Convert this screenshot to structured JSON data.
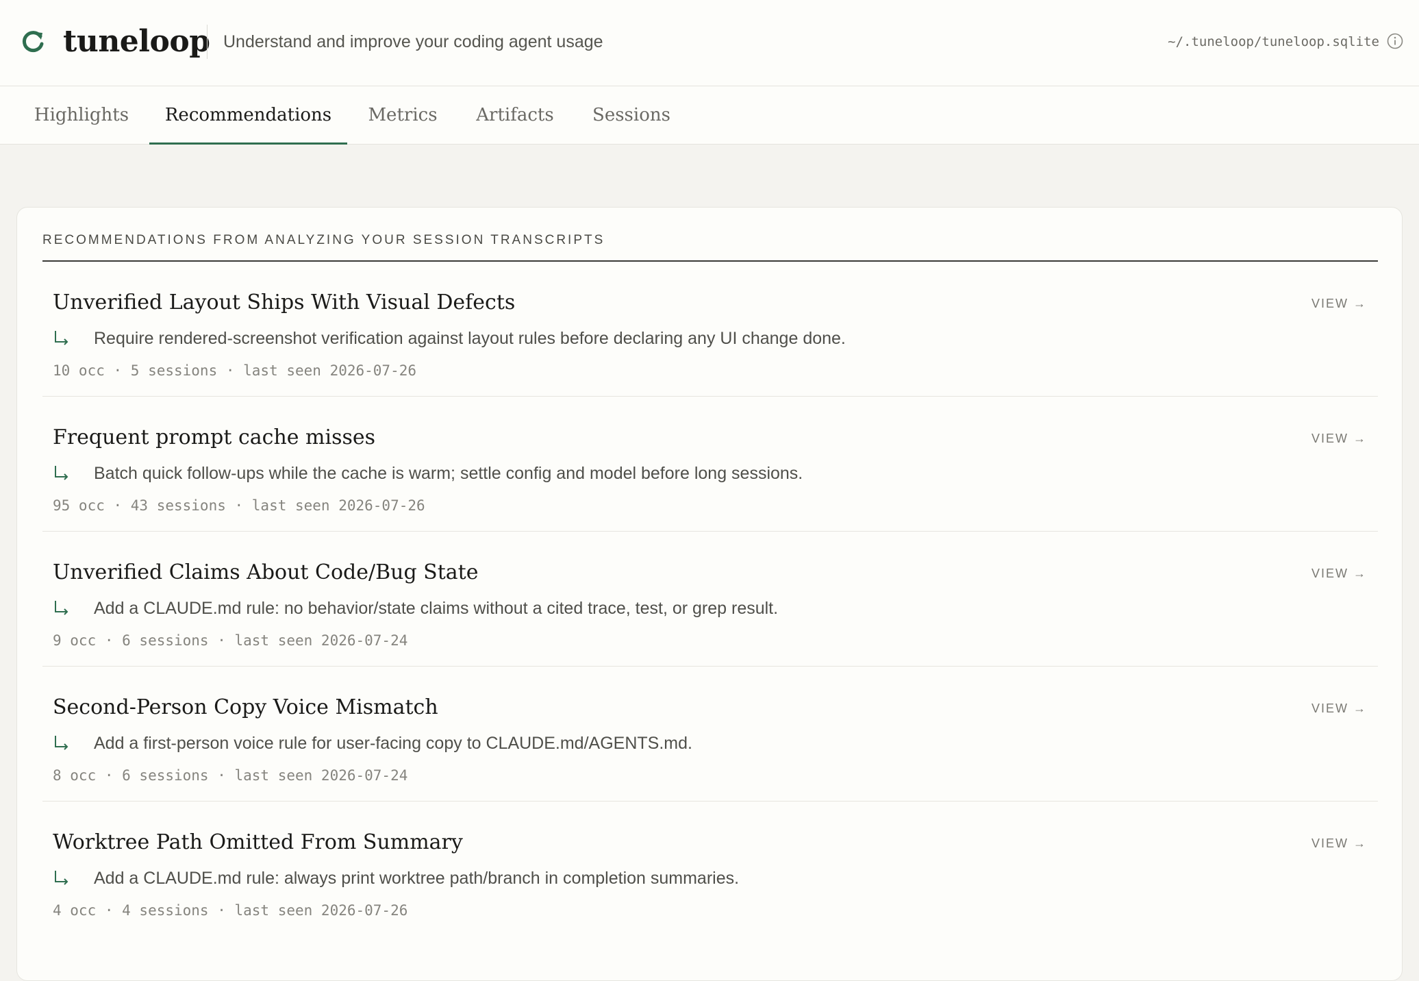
{
  "app": {
    "name": "tuneloop",
    "tagline": "Understand and improve your coding agent usage",
    "db_path": "~/.tuneloop/tuneloop.sqlite",
    "accent_color": "#2f6e4f",
    "logo_icon": "refresh-icon"
  },
  "tabs": [
    {
      "label": "Highlights",
      "active": false
    },
    {
      "label": "Recommendations",
      "active": true
    },
    {
      "label": "Metrics",
      "active": false
    },
    {
      "label": "Artifacts",
      "active": false
    },
    {
      "label": "Sessions",
      "active": false
    }
  ],
  "recommendations": {
    "heading": "RECOMMENDATIONS FROM ANALYZING YOUR SESSION TRANSCRIPTS",
    "view_label": "VIEW →",
    "items": [
      {
        "title": "Unverified Layout Ships With Visual Defects",
        "action": "Require rendered-screenshot verification against layout rules before declaring any UI change done.",
        "meta": "10 occ · 5 sessions · last seen 2026-07-26"
      },
      {
        "title": "Frequent prompt cache misses",
        "action": "Batch quick follow-ups while the cache is warm; settle config and model before long sessions.",
        "meta": "95 occ · 43 sessions · last seen 2026-07-26"
      },
      {
        "title": "Unverified Claims About Code/Bug State",
        "action": "Add a CLAUDE.md rule: no behavior/state claims without a cited trace, test, or grep result.",
        "meta": "9 occ · 6 sessions · last seen 2026-07-24"
      },
      {
        "title": "Second-Person Copy Voice Mismatch",
        "action": "Add a first-person voice rule for user-facing copy to CLAUDE.md/AGENTS.md.",
        "meta": "8 occ · 6 sessions · last seen 2026-07-24"
      },
      {
        "title": "Worktree Path Omitted From Summary",
        "action": "Add a CLAUDE.md rule: always print worktree path/branch in completion summaries.",
        "meta": "4 occ · 4 sessions · last seen 2026-07-26"
      }
    ]
  }
}
